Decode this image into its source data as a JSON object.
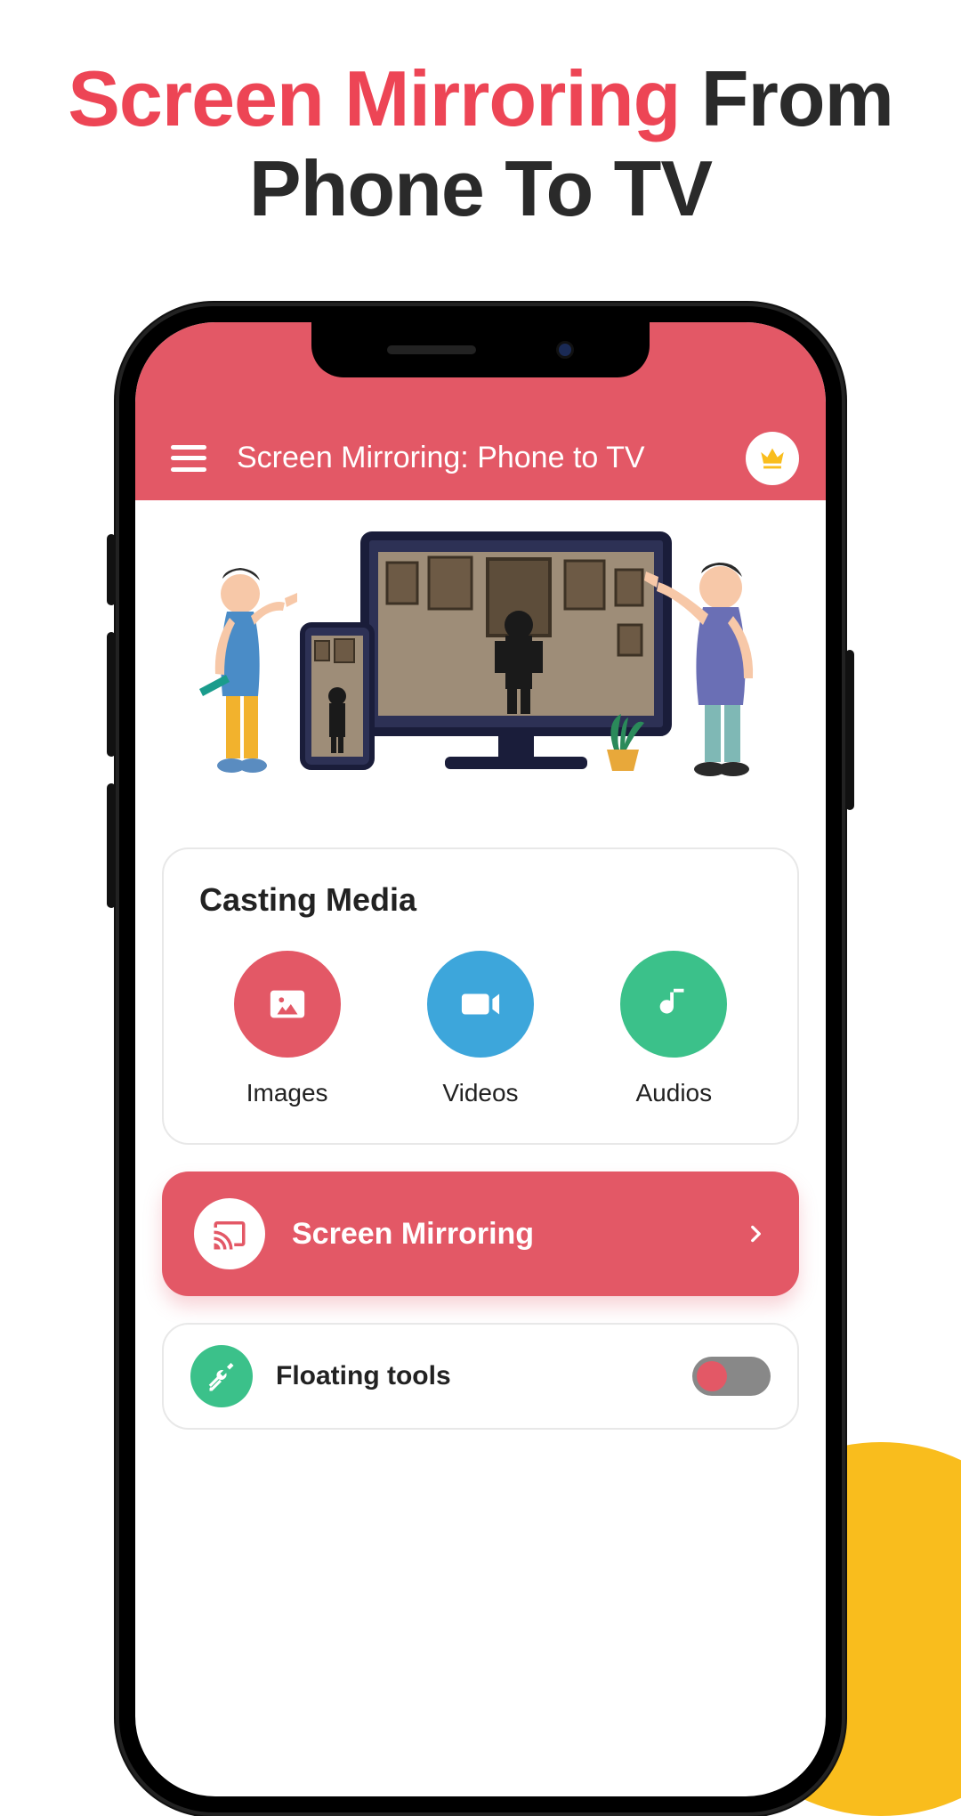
{
  "headline": {
    "highlight": "Screen Mirroring",
    "rest1": " From",
    "rest2": "Phone To TV"
  },
  "appbar": {
    "title": "Screen Mirroring: Phone to TV"
  },
  "casting": {
    "title": "Casting Media",
    "items": [
      {
        "label": "Images"
      },
      {
        "label": "Videos"
      },
      {
        "label": "Audios"
      }
    ]
  },
  "mirror": {
    "label": "Screen Mirroring"
  },
  "floating": {
    "label": "Floating tools"
  }
}
